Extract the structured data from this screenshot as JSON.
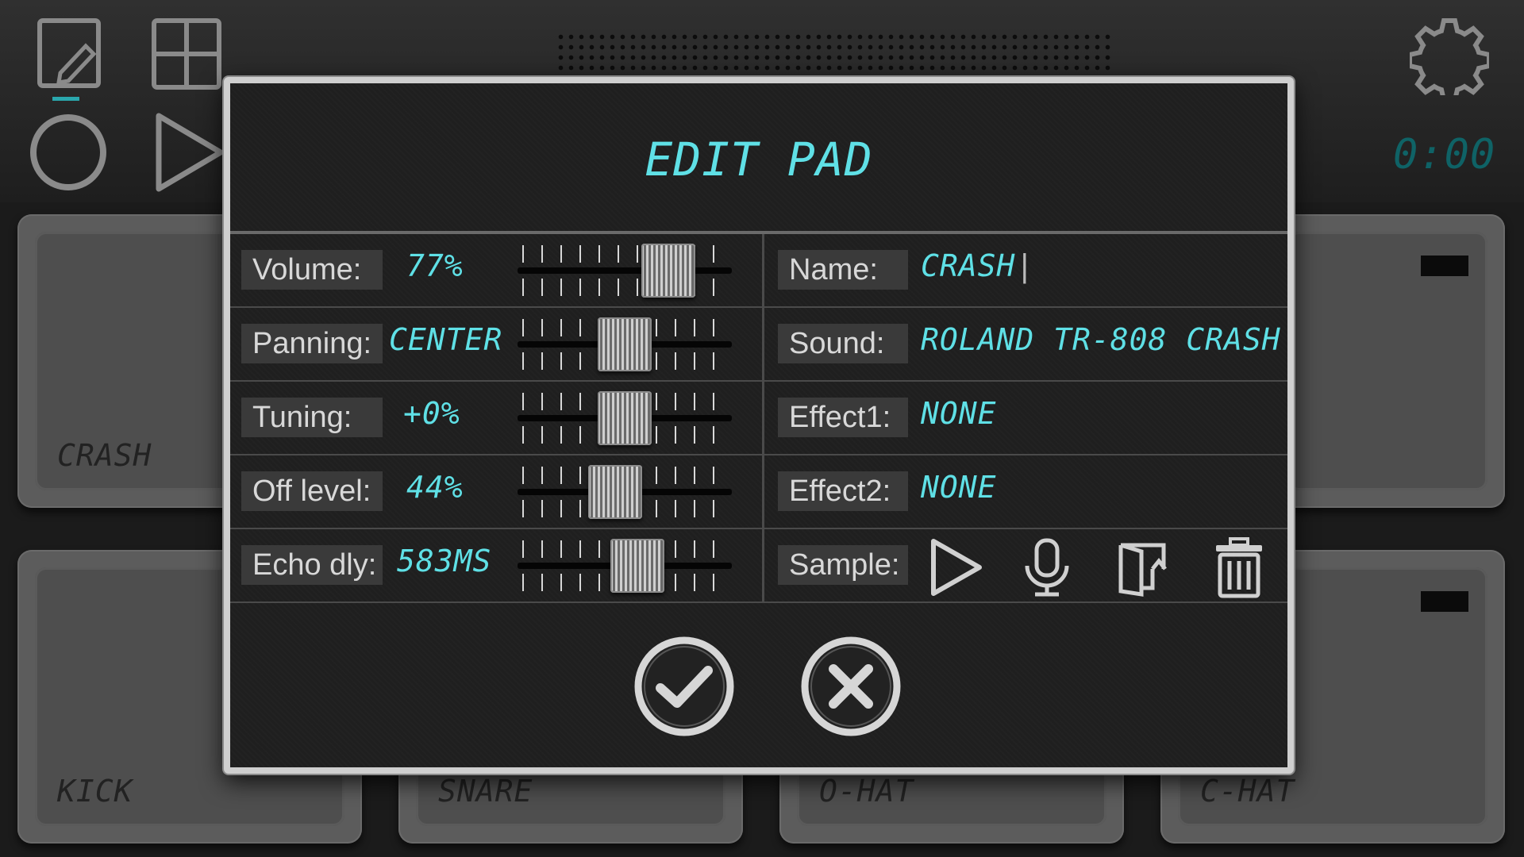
{
  "app": {
    "timer": "0:00",
    "icons": [
      "edit-icon",
      "grid-icon",
      "record-icon",
      "play-icon",
      "settings-icon"
    ]
  },
  "pads": [
    {
      "label": "CRASH"
    },
    {
      "label": "KICK"
    },
    {
      "label": "SNARE"
    },
    {
      "label": "O-HAT"
    },
    {
      "label": "C-HAT"
    }
  ],
  "dialog": {
    "title": "EDIT PAD",
    "controls": [
      {
        "label": "Volume:",
        "value": "77%",
        "level": 0.77
      },
      {
        "label": "Panning:",
        "value": "CENTER",
        "level": 0.5
      },
      {
        "label": "Tuning:",
        "value": "+0%",
        "level": 0.5
      },
      {
        "label": "Off level:",
        "value": "44%",
        "level": 0.44
      },
      {
        "label": "Echo dly:",
        "value": "583MS",
        "level": 0.58
      }
    ],
    "fields": [
      {
        "label": "Name:",
        "value": "CRASH"
      },
      {
        "label": "Sound:",
        "value": "ROLAND TR-808 CRASH"
      },
      {
        "label": "Effect1:",
        "value": "NONE"
      },
      {
        "label": "Effect2:",
        "value": "NONE"
      }
    ],
    "sample": {
      "label": "Sample:",
      "icons": [
        "play-icon",
        "microphone-icon",
        "open-file-icon",
        "trash-icon"
      ]
    },
    "confirm_icon": "check-icon",
    "cancel_icon": "close-icon",
    "accent_color": "#5fe0e6"
  }
}
